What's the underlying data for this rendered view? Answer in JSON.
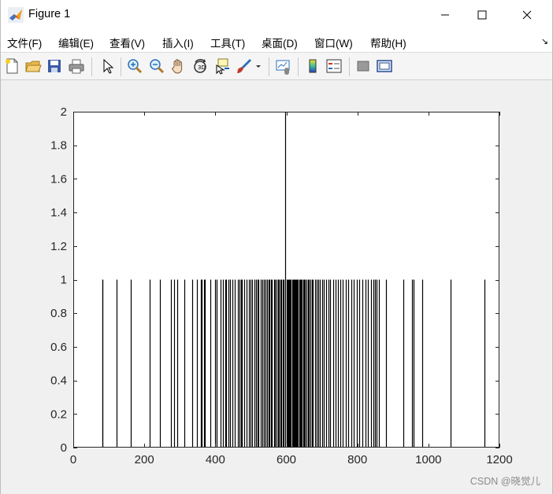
{
  "window": {
    "title": "Figure 1",
    "controls": {
      "minimize": "minimize",
      "maximize": "maximize",
      "close": "close"
    }
  },
  "menu": {
    "items": [
      {
        "label": "文件(F)"
      },
      {
        "label": "编辑(E)"
      },
      {
        "label": "查看(V)"
      },
      {
        "label": "插入(I)"
      },
      {
        "label": "工具(T)"
      },
      {
        "label": "桌面(D)"
      },
      {
        "label": "窗口(W)"
      },
      {
        "label": "帮助(H)"
      }
    ],
    "dock_icon": "↘"
  },
  "toolbar": {
    "icons": [
      "new-figure-icon",
      "open-file-icon",
      "save-icon",
      "print-icon",
      "select-arrow-icon",
      "zoom-in-icon",
      "zoom-out-icon",
      "pan-hand-icon",
      "rotate-3d-icon",
      "data-cursor-icon",
      "brush-icon",
      "brush-dropdown-icon",
      "link-plot-icon",
      "colorbar-icon",
      "legend-icon",
      "hide-plot-tools-icon",
      "show-plot-tools-icon"
    ]
  },
  "chart_data": {
    "type": "bar",
    "title": "",
    "xlabel": "",
    "ylabel": "",
    "xlim": [
      0,
      1200
    ],
    "ylim": [
      0,
      2
    ],
    "xticks": [
      "0",
      "200",
      "400",
      "600",
      "800",
      "1000",
      "1200"
    ],
    "yticks": [
      "0",
      "0.2",
      "0.4",
      "0.6",
      "0.8",
      "1",
      "1.2",
      "1.4",
      "1.6",
      "1.8",
      "2"
    ],
    "grid": false,
    "bar_color": "#000000",
    "series": [
      {
        "x": [
          82,
          83,
          121,
          162,
          216,
          244,
          276,
          284,
          292,
          313,
          336,
          349,
          359,
          362,
          368,
          370,
          385,
          399,
          404,
          415,
          421,
          428,
          430,
          437,
          442,
          447,
          455,
          464,
          469,
          472,
          475,
          482,
          489,
          494,
          498,
          503,
          510,
          515,
          518,
          522,
          527,
          532,
          536,
          541,
          545,
          549,
          552,
          556,
          560,
          565,
          568,
          572,
          576,
          580,
          584,
          586,
          589,
          592,
          596,
          601,
          603,
          606,
          608,
          611,
          613,
          616,
          618,
          621,
          623,
          626,
          628,
          631,
          633,
          636,
          639,
          641,
          644,
          647,
          650,
          653,
          656,
          660,
          663,
          667,
          671,
          675,
          680,
          685,
          690,
          695,
          700,
          706,
          712,
          718,
          724,
          731,
          738,
          745,
          752,
          759,
          767,
          775,
          783,
          790,
          798,
          806,
          814,
          822,
          830,
          838,
          845,
          850,
          855,
          860,
          881,
          930,
          953,
          958,
          983,
          1062,
          1157
        ],
        "values": [
          1,
          1,
          1,
          1,
          1,
          1,
          1,
          1,
          1,
          1,
          1,
          1,
          1,
          1,
          1,
          1,
          1,
          1,
          1,
          1,
          1,
          1,
          1,
          1,
          1,
          1,
          1,
          1,
          1,
          1,
          1,
          1,
          1,
          1,
          1,
          1,
          1,
          1,
          1,
          1,
          1,
          1,
          1,
          1,
          1,
          1,
          1,
          1,
          1,
          1,
          1,
          1,
          1,
          1,
          1,
          1,
          1,
          1,
          2,
          1,
          1,
          1,
          1,
          1,
          1,
          1,
          1,
          1,
          1,
          1,
          1,
          1,
          1,
          1,
          1,
          1,
          1,
          1,
          1,
          1,
          1,
          1,
          1,
          1,
          1,
          1,
          1,
          1,
          1,
          1,
          1,
          1,
          1,
          1,
          1,
          1,
          1,
          1,
          1,
          1,
          1,
          1,
          1,
          1,
          1,
          1,
          1,
          1,
          1,
          1,
          1,
          1,
          1,
          1,
          1,
          1,
          1,
          1,
          1,
          1,
          1
        ]
      }
    ]
  },
  "watermark": "CSDN @晓觉儿"
}
